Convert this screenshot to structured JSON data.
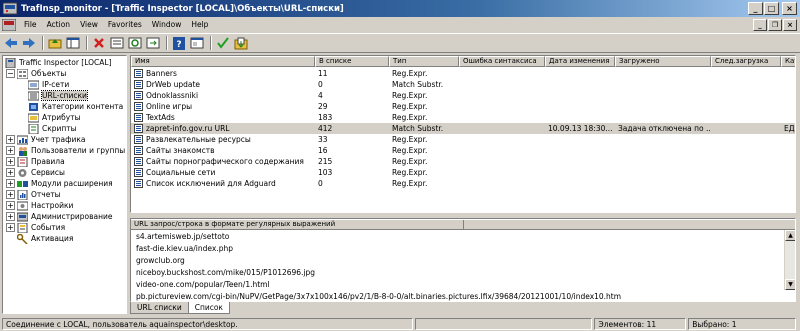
{
  "window": {
    "title": "TrafInsp_monitor - [Traffic Inspector [LOCAL]\\Объекты\\URL-списки]"
  },
  "menu": {
    "items": [
      "File",
      "Action",
      "View",
      "Favorites",
      "Window",
      "Help"
    ]
  },
  "tree": {
    "items": [
      {
        "label": "Traffic Inspector [LOCAL]",
        "icon": "server-icon"
      },
      {
        "label": "Объекты",
        "icon": "objects-icon"
      },
      {
        "label": "IP-сети",
        "icon": "network-icon"
      },
      {
        "label": "URL-списки",
        "icon": "url-list-icon"
      },
      {
        "label": "Категории контента",
        "icon": "category-icon"
      },
      {
        "label": "Атрибуты",
        "icon": "attribute-icon"
      },
      {
        "label": "Скрипты",
        "icon": "script-icon"
      },
      {
        "label": "Учет трафика",
        "icon": "traffic-icon"
      },
      {
        "label": "Пользователи и группы",
        "icon": "users-icon"
      },
      {
        "label": "Правила",
        "icon": "rules-icon"
      },
      {
        "label": "Сервисы",
        "icon": "services-icon"
      },
      {
        "label": "Модули расширения",
        "icon": "modules-icon"
      },
      {
        "label": "Отчеты",
        "icon": "reports-icon"
      },
      {
        "label": "Настройки",
        "icon": "settings-icon"
      },
      {
        "label": "Администрирование",
        "icon": "admin-icon"
      },
      {
        "label": "События",
        "icon": "events-icon"
      },
      {
        "label": "Активация",
        "icon": "key-icon"
      }
    ]
  },
  "list": {
    "columns": [
      "Имя",
      "В списке",
      "Тип",
      "Ошибка синтаксиса",
      "Дата изменения",
      "Загружено",
      "След.загрузка",
      "Кат"
    ],
    "rows": [
      {
        "name": "Banners",
        "count": "11",
        "type": "Reg.Expr.",
        "error": "",
        "date": "",
        "loaded": "",
        "next": "",
        "extra": ""
      },
      {
        "name": "DrWeb update",
        "count": "0",
        "type": "Match Substr.",
        "error": "",
        "date": "",
        "loaded": "",
        "next": "",
        "extra": ""
      },
      {
        "name": "Odnoklassniki",
        "count": "4",
        "type": "Reg.Expr.",
        "error": "",
        "date": "",
        "loaded": "",
        "next": "",
        "extra": ""
      },
      {
        "name": "Online игры",
        "count": "29",
        "type": "Reg.Expr.",
        "error": "",
        "date": "",
        "loaded": "",
        "next": "",
        "extra": ""
      },
      {
        "name": "TextAds",
        "count": "183",
        "type": "Reg.Expr.",
        "error": "",
        "date": "",
        "loaded": "",
        "next": "",
        "extra": ""
      },
      {
        "name": "zapret-info.gov.ru URL",
        "count": "412",
        "type": "Match Substr.",
        "error": "",
        "date": "10.09.13 18:30...",
        "loaded": "Задача отключена по ...",
        "next": "",
        "extra": "ЕДИ"
      },
      {
        "name": "Развлекательные ресурсы",
        "count": "33",
        "type": "Reg.Expr.",
        "error": "",
        "date": "",
        "loaded": "",
        "next": "",
        "extra": ""
      },
      {
        "name": "Сайты знакомств",
        "count": "16",
        "type": "Reg.Expr.",
        "error": "",
        "date": "",
        "loaded": "",
        "next": "",
        "extra": ""
      },
      {
        "name": "Сайты порнографического содержания",
        "count": "215",
        "type": "Reg.Expr.",
        "error": "",
        "date": "",
        "loaded": "",
        "next": "",
        "extra": ""
      },
      {
        "name": "Социальные сети",
        "count": "103",
        "type": "Reg.Expr.",
        "error": "",
        "date": "",
        "loaded": "",
        "next": "",
        "extra": ""
      },
      {
        "name": "Список исключений для Adguard",
        "count": "0",
        "type": "Reg.Expr.",
        "error": "",
        "date": "",
        "loaded": "",
        "next": "",
        "extra": ""
      }
    ]
  },
  "detail": {
    "header": "URL запрос/строка в формате регулярных выражений",
    "lines": [
      "s4.artemisweb.jp/settoto",
      "fast-die.kiev.ua/index.php",
      "growclub.org",
      "niceboy.buckshost.com/mike/015/P1012696.jpg",
      "video-one.com/popular/Teen/1.html",
      "pb.pictureview.com/cgi-bin/NuPV/GetPage/3x7x100x146/pv2/1/B-8-0-0/alt.binaries.pictures.lfix/39684/20121001/10/index10.htm"
    ]
  },
  "tabs": [
    "URL списки",
    "Список"
  ],
  "status": {
    "connection": "Соединение с LOCAL, пользователь aquainspector\\desktop.",
    "elements": "Элементов: 11",
    "selected": "Выбрано: 1"
  }
}
